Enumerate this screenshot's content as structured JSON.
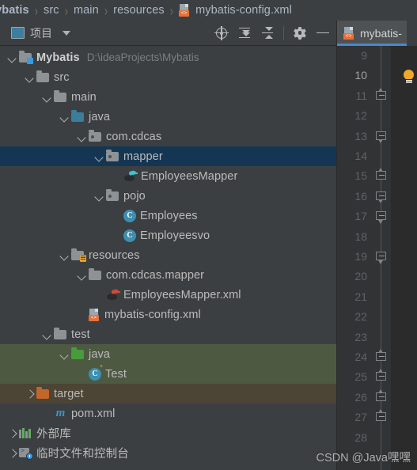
{
  "breadcrumb": {
    "items": [
      "lybatis",
      "src",
      "main",
      "resources"
    ],
    "file": "mybatis-config.xml",
    "separator": "›",
    "file_icon": "xml-config-icon",
    "tag_text": "<>"
  },
  "panel": {
    "title": "项目",
    "title_icon": "project-view-icon",
    "dropdown_icon": "chevron-down-icon",
    "actions": [
      {
        "name": "locate-icon",
        "tooltip": "Select Opened File"
      },
      {
        "name": "expand-all-icon",
        "tooltip": "Expand All"
      },
      {
        "name": "collapse-all-icon",
        "tooltip": "Collapse All"
      },
      {
        "name": "settings-gear-icon",
        "tooltip": "Options"
      },
      {
        "name": "hide-icon",
        "tooltip": "Hide"
      }
    ]
  },
  "tree": {
    "rows": [
      {
        "label": "Mybatis",
        "hint": "D:\\ideaProjects\\Mybatis",
        "depth": 0,
        "arrow": "down",
        "icon": "module-folder-icon",
        "bold": true,
        "state": "normal"
      },
      {
        "label": "src",
        "hint": "",
        "depth": 1,
        "arrow": "down",
        "icon": "folder-icon",
        "bold": false,
        "state": "normal"
      },
      {
        "label": "main",
        "hint": "",
        "depth": 2,
        "arrow": "down",
        "icon": "folder-icon",
        "bold": false,
        "state": "normal"
      },
      {
        "label": "java",
        "hint": "",
        "depth": 3,
        "arrow": "down",
        "icon": "source-folder-icon",
        "bold": false,
        "state": "normal"
      },
      {
        "label": "com.cdcas",
        "hint": "",
        "depth": 4,
        "arrow": "down",
        "icon": "package-icon",
        "bold": false,
        "state": "normal"
      },
      {
        "label": "mapper",
        "hint": "",
        "depth": 5,
        "arrow": "down",
        "icon": "package-icon",
        "bold": false,
        "state": "selected"
      },
      {
        "label": "EmployeesMapper",
        "hint": "",
        "depth": 6,
        "arrow": "none",
        "icon": "mybatis-mapper-icon",
        "bold": false,
        "state": "normal"
      },
      {
        "label": "pojo",
        "hint": "",
        "depth": 5,
        "arrow": "down",
        "icon": "package-icon",
        "bold": false,
        "state": "normal"
      },
      {
        "label": "Employees",
        "hint": "",
        "depth": 6,
        "arrow": "none",
        "icon": "java-class-icon",
        "bold": false,
        "state": "normal"
      },
      {
        "label": "Employeesvo",
        "hint": "",
        "depth": 6,
        "arrow": "none",
        "icon": "java-class-icon",
        "bold": false,
        "state": "normal"
      },
      {
        "label": "resources",
        "hint": "",
        "depth": 3,
        "arrow": "down",
        "icon": "resources-folder-icon",
        "bold": false,
        "state": "normal"
      },
      {
        "label": "com.cdcas.mapper",
        "hint": "",
        "depth": 4,
        "arrow": "down",
        "icon": "folder-icon",
        "bold": false,
        "state": "normal"
      },
      {
        "label": "EmployeesMapper.xml",
        "hint": "",
        "depth": 5,
        "arrow": "none",
        "icon": "mybatis-mapper-xml-icon",
        "bold": false,
        "state": "normal"
      },
      {
        "label": "mybatis-config.xml",
        "hint": "",
        "depth": 4,
        "arrow": "none",
        "icon": "xml-config-icon",
        "bold": false,
        "state": "normal"
      },
      {
        "label": "test",
        "hint": "",
        "depth": 2,
        "arrow": "down",
        "icon": "folder-icon",
        "bold": false,
        "state": "normal"
      },
      {
        "label": "java",
        "hint": "",
        "depth": 3,
        "arrow": "down",
        "icon": "test-source-folder-icon",
        "bold": false,
        "state": "test"
      },
      {
        "label": "Test",
        "hint": "",
        "depth": 4,
        "arrow": "none",
        "icon": "runnable-class-icon",
        "bold": false,
        "state": "test"
      },
      {
        "label": "target",
        "hint": "",
        "depth": 1,
        "arrow": "right",
        "icon": "excluded-folder-icon",
        "bold": false,
        "state": "target"
      },
      {
        "label": "pom.xml",
        "hint": "",
        "depth": 2,
        "arrow": "none",
        "icon": "maven-icon",
        "bold": false,
        "state": "normal"
      },
      {
        "label": "外部库",
        "hint": "",
        "depth": 0,
        "arrow": "right",
        "icon": "external-libraries-icon",
        "bold": false,
        "state": "normal"
      },
      {
        "label": "临时文件和控制台",
        "hint": "",
        "depth": 0,
        "arrow": "right",
        "icon": "scratches-consoles-icon",
        "bold": false,
        "state": "normal"
      }
    ]
  },
  "editor": {
    "tab": {
      "label": "mybatis-",
      "icon": "xml-config-icon",
      "tag_text": "<>",
      "active": true
    },
    "line_numbers": [
      9,
      10,
      11,
      12,
      13,
      14,
      15,
      16,
      17,
      18,
      19,
      20,
      21,
      22,
      23,
      24,
      25,
      26,
      27,
      28
    ],
    "current_line": 10,
    "fold_markers": [
      {
        "line": 11,
        "type": "open"
      },
      {
        "line": 13,
        "type": "close"
      },
      {
        "line": 15,
        "type": "open"
      },
      {
        "line": 16,
        "type": "close"
      },
      {
        "line": 17,
        "type": "close"
      },
      {
        "line": 19,
        "type": "close"
      },
      {
        "line": 24,
        "type": "open"
      },
      {
        "line": 25,
        "type": "open"
      },
      {
        "line": 26,
        "type": "open"
      },
      {
        "line": 27,
        "type": "open"
      }
    ],
    "intention_icon": "lightbulb-icon"
  },
  "watermark": "CSDN @Java嘿嘿",
  "colors": {
    "panel_bg": "#3c3f41",
    "editor_bg": "#2b2b2b",
    "gutter_bg": "#313335",
    "selection": "#143653",
    "test_source": "#4e5942",
    "excluded": "#4c4434",
    "tab_underline": "#4a88c7",
    "accent_orange": "#e8703a",
    "text": "#bbbbbb"
  }
}
